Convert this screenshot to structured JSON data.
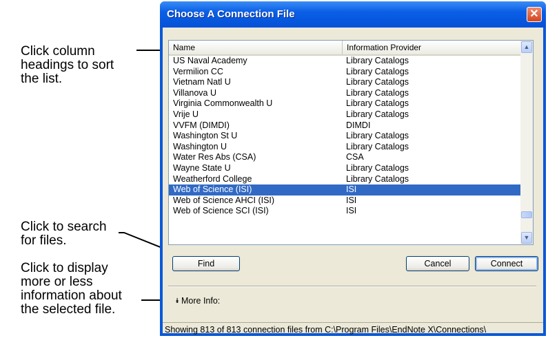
{
  "dialog": {
    "title": "Choose A Connection File",
    "close_glyph": "✕"
  },
  "callouts": {
    "sort": "Click column\nheadings to sort\nthe list.",
    "search": "Click to search\nfor files.",
    "info": "Click to display\nmore or less\ninformation about\nthe selected file."
  },
  "list": {
    "columns": [
      "Name",
      "Information Provider"
    ],
    "rows": [
      {
        "name": "US Naval Academy",
        "provider": "Library Catalogs"
      },
      {
        "name": "Vermilion CC",
        "provider": "Library Catalogs"
      },
      {
        "name": "Vietnam Natl U",
        "provider": "Library Catalogs"
      },
      {
        "name": "Villanova U",
        "provider": "Library Catalogs"
      },
      {
        "name": "Virginia Commonwealth U",
        "provider": "Library Catalogs"
      },
      {
        "name": "Vrije U",
        "provider": "Library Catalogs"
      },
      {
        "name": "VVFM (DIMDI)",
        "provider": "DIMDI"
      },
      {
        "name": "Washington St U",
        "provider": "Library Catalogs"
      },
      {
        "name": "Washington U",
        "provider": "Library Catalogs"
      },
      {
        "name": "Water Res Abs (CSA)",
        "provider": "CSA"
      },
      {
        "name": "Wayne State U",
        "provider": "Library Catalogs"
      },
      {
        "name": "Weatherford College",
        "provider": "Library Catalogs"
      },
      {
        "name": "Web of Science (ISI)",
        "provider": "ISI",
        "selected": true
      },
      {
        "name": "Web of Science AHCI (ISI)",
        "provider": "ISI"
      },
      {
        "name": "Web of Science SCI (ISI)",
        "provider": "ISI"
      }
    ],
    "scroll_up_glyph": "▲",
    "scroll_down_glyph": "▼"
  },
  "buttons": {
    "find": "Find",
    "cancel": "Cancel",
    "connect": "Connect"
  },
  "more_info": {
    "icon": "double-chevron-down-icon",
    "glyph": "⯯",
    "label": "More Info:"
  },
  "status": "Showing 813 of 813 connection files from C:\\Program Files\\EndNote X\\Connections\\",
  "colors": {
    "titlebar": "#0a5fe6",
    "selection": "#316ac5",
    "dialog_bg": "#ece9d8",
    "close_button": "#d2461f"
  }
}
